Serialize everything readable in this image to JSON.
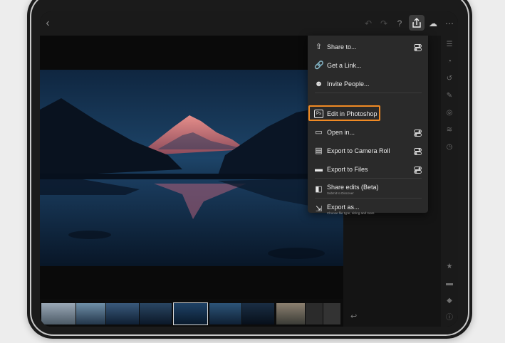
{
  "share_menu": {
    "items": [
      {
        "label": "Share to...",
        "icon": "share-icon",
        "has_toggle": true
      },
      {
        "label": "Get a Link...",
        "icon": "link-icon",
        "has_toggle": false
      },
      {
        "label": "Invite People...",
        "icon": "invite-people-icon",
        "has_toggle": false
      },
      {
        "label": "Edit in Photoshop",
        "icon": "photoshop-icon",
        "has_toggle": false,
        "highlighted": true
      },
      {
        "label": "Open in...",
        "icon": "open-in-icon",
        "has_toggle": true
      },
      {
        "label": "Export to Camera Roll",
        "icon": "camera-roll-icon",
        "has_toggle": true
      },
      {
        "label": "Export to Files",
        "icon": "folder-icon",
        "has_toggle": true
      },
      {
        "label": "Share edits (Beta)",
        "sublabel": "Submit to Discover",
        "icon": "share-edits-icon",
        "has_toggle": false
      },
      {
        "label": "Export as...",
        "sublabel": "Choose file type, sizing and more",
        "icon": "export-as-icon",
        "has_toggle": false
      }
    ],
    "photoshop_icon_text": "Ps"
  },
  "colors": {
    "highlight": "#f08a24",
    "menu_bg": "#2a2a2a",
    "screen_bg": "#0d0d0d"
  },
  "toolbar_icons": [
    "back-icon",
    "undo-icon",
    "redo-icon",
    "help-icon",
    "share-icon",
    "cloud-sync-icon",
    "more-icon"
  ],
  "right_tools": [
    "edit-sliders-icon",
    "healing-icon",
    "geometry-icon",
    "brush-icon",
    "masking-icon",
    "presets-icon",
    "versions-icon"
  ],
  "bottom_tools": [
    "star-icon",
    "comment-icon",
    "tag-icon",
    "info-icon"
  ]
}
